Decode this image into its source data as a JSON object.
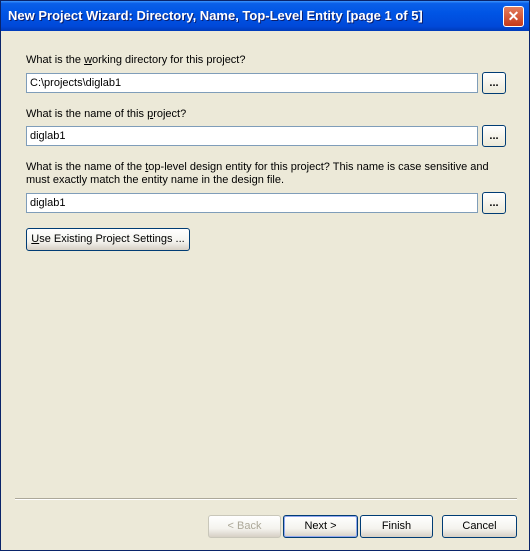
{
  "window": {
    "title": "New Project Wizard: Directory, Name, Top-Level Entity [page 1 of 5]",
    "close_glyph": "✕"
  },
  "form": {
    "dir_label_pre": "What is the ",
    "dir_label_u": "w",
    "dir_label_post": "orking directory for this project?",
    "dir_value": "C:\\projects\\diglab1",
    "name_label_pre": "What is the name of this ",
    "name_label_u": "p",
    "name_label_post": "roject?",
    "name_value": "diglab1",
    "entity_label_pre": "What is the name of the ",
    "entity_label_u": "t",
    "entity_label_post": "op-level design entity for this project? This name is case sensitive and must exactly match the entity name in the design file.",
    "entity_value": "diglab1",
    "browse_label": "...",
    "use_existing_u": "U",
    "use_existing_rest": "se Existing Project Settings ..."
  },
  "footer": {
    "back": "< Back",
    "next": "Next >",
    "finish": "Finish",
    "cancel": "Cancel"
  }
}
